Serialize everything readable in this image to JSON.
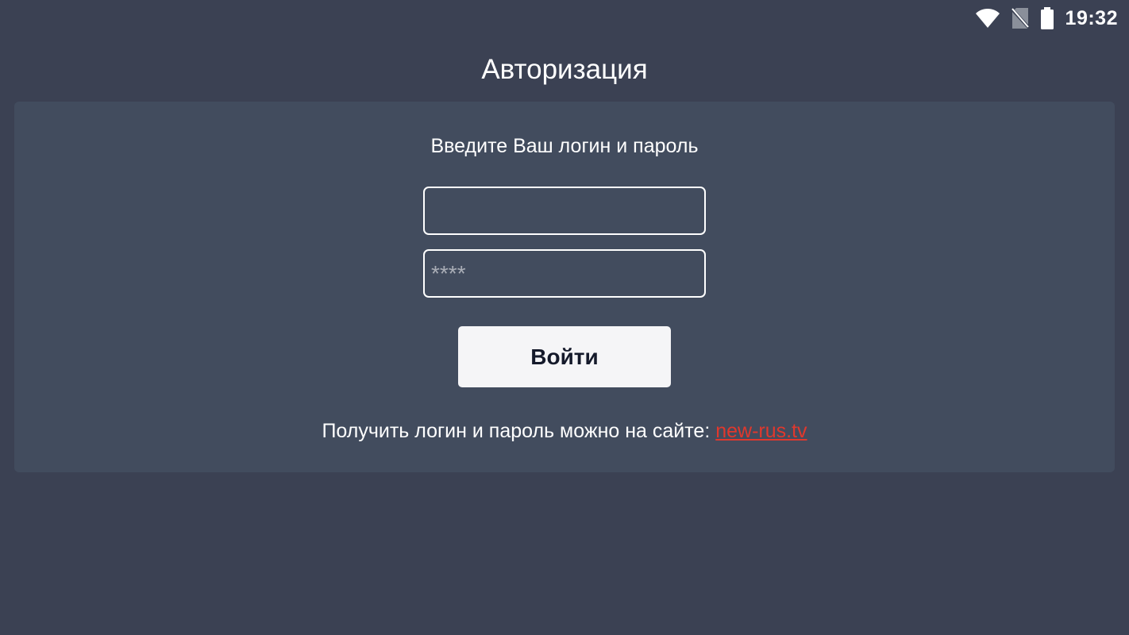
{
  "status_bar": {
    "time": "19:32",
    "icons": [
      "wifi-icon",
      "no-sim-icon",
      "battery-icon"
    ]
  },
  "page": {
    "title": "Авторизация"
  },
  "login_form": {
    "prompt": "Введите Ваш логин и пароль",
    "login_value": "",
    "login_placeholder": "",
    "password_placeholder": "****",
    "submit_label": "Войти",
    "info_text": "Получить логин и пароль можно на сайте: ",
    "site_link": "new-rus.tv"
  },
  "colors": {
    "background": "#3b4153",
    "card": "#424c5e",
    "link": "#e0382d",
    "button_bg": "#f5f5f7",
    "button_text": "#151a2b"
  }
}
